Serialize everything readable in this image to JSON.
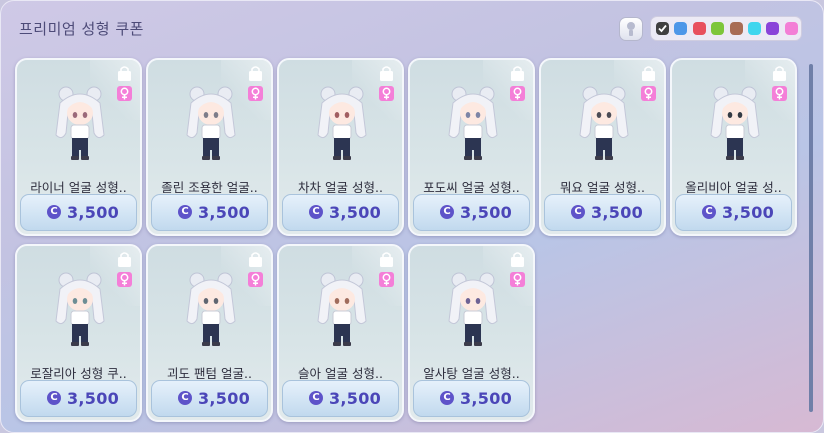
{
  "window": {
    "title": "프리미엄 성형 쿠폰"
  },
  "filters": {
    "gender_icon": "person-icon",
    "colors": [
      "#404040",
      "#4d97e8",
      "#e8505d",
      "#7dc63b",
      "#a86c55",
      "#3fd6ee",
      "#8a44d9",
      "#f37fd6"
    ],
    "selected_color_index": 0
  },
  "currency": {
    "symbol": "C"
  },
  "items": [
    {
      "name": "라이너 얼굴 성형..",
      "price": "3,500"
    },
    {
      "name": "졸린 조용한 얼굴..",
      "price": "3,500"
    },
    {
      "name": "차차 얼굴 성형..",
      "price": "3,500"
    },
    {
      "name": "포도씨 얼굴 성형..",
      "price": "3,500"
    },
    {
      "name": "뭐요 얼굴 성형..",
      "price": "3,500"
    },
    {
      "name": "올리비아 얼굴 성..",
      "price": "3,500"
    },
    {
      "name": "로잘리아 성형 쿠..",
      "price": "3,500"
    },
    {
      "name": "괴도 팬텀 얼굴..",
      "price": "3,500"
    },
    {
      "name": "슬아 얼굴 성형..",
      "price": "3,500"
    },
    {
      "name": "알사탕 얼굴 성형..",
      "price": "3,500"
    }
  ]
}
